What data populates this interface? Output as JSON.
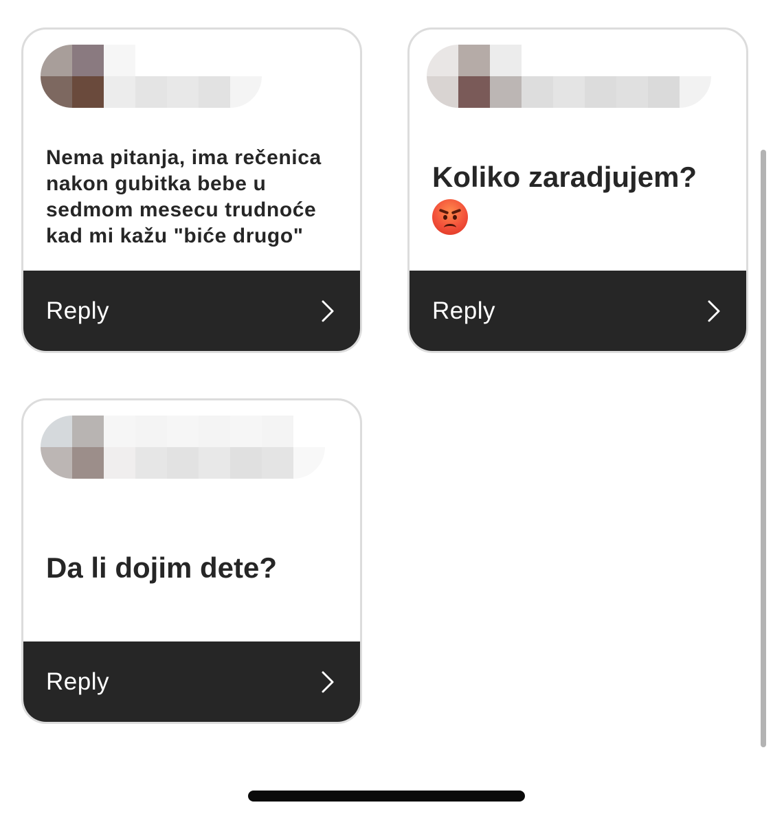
{
  "cards": [
    {
      "question": "Nema pitanja, ima rečenica nakon gubitka bebe u sedmom mesecu trudnoće kad mi kažu \"biće drugo\"",
      "reply_label": "Reply",
      "avatar_colors": [
        "#8a7a75",
        "#c9c0bd",
        "#6b4a3f",
        "#e5dcd9"
      ],
      "name_blur_colors": [
        "#e8e8e8",
        "#dcdcdc",
        "#e4e4e4",
        "#e0e0e0",
        "#e6e6e6"
      ]
    },
    {
      "question": "Koliko zaradjujem?",
      "emoji": "angry-face",
      "reply_label": "Reply",
      "avatar_colors": [
        "#c8c0bd",
        "#e8e4e3",
        "#7a5a58",
        "#b8b0ae"
      ],
      "name_blur_colors": [
        "#dcdcdc",
        "#e2e2e2",
        "#dadada",
        "#e0e0e0",
        "#dcdcdc"
      ]
    },
    {
      "question": "Da li dojim dete?",
      "reply_label": "Reply",
      "avatar_colors": [
        "#cfd3d6",
        "#b8b4b2",
        "#a09490",
        "#f0eeee"
      ],
      "name_blur_colors": [
        "#e4e4e4",
        "#e0e0e0",
        "#e6e6e6",
        "#dedede",
        "#e2e2e2"
      ]
    }
  ],
  "colors": {
    "reply_bar": "#262626",
    "card_border": "#dcdcdc",
    "question_text": "#262626"
  }
}
